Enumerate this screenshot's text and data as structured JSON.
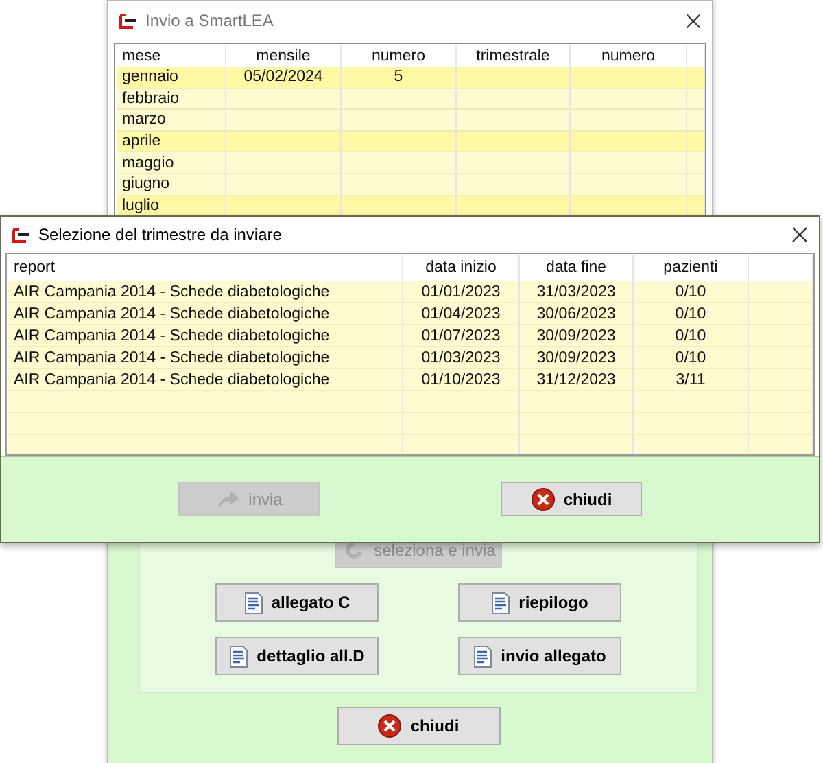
{
  "back_window": {
    "title": "Invio a SmartLEA",
    "table": {
      "columns": [
        "mese",
        "mensile",
        "numero",
        "trimestrale",
        "numero"
      ],
      "rows": [
        {
          "cells": [
            "gennaio",
            "05/02/2024",
            "5"
          ],
          "highlighted": true
        },
        {
          "cells": [
            "febbraio"
          ],
          "highlighted": false
        },
        {
          "cells": [
            "marzo"
          ],
          "highlighted": false
        },
        {
          "cells": [
            "aprile"
          ],
          "highlighted": true
        },
        {
          "cells": [
            "maggio"
          ],
          "highlighted": false
        },
        {
          "cells": [
            "giugno"
          ],
          "highlighted": false
        },
        {
          "cells": [
            "luglio"
          ],
          "highlighted": true
        }
      ]
    },
    "buttons": [
      {
        "label": "seleziona e invia",
        "kind": "swirl",
        "disabled": true
      },
      {
        "label": "allegato C",
        "kind": "document",
        "disabled": false
      },
      {
        "label": "riepilogo",
        "kind": "document",
        "disabled": false
      },
      {
        "label": "dettaglio all.D",
        "kind": "document",
        "disabled": false
      },
      {
        "label": "invio allegato",
        "kind": "document",
        "disabled": false
      }
    ],
    "close_button": {
      "label": "chiudi",
      "kind": "close",
      "disabled": false
    }
  },
  "dialog": {
    "title": "Selezione del trimestre da inviare",
    "table": {
      "columns": [
        "report",
        "data inizio",
        "data fine",
        "pazienti"
      ],
      "rows": [
        {
          "cells": [
            "AIR Campania 2014 - Schede diabetologiche",
            "01/01/2023",
            "31/03/2023",
            "0/10"
          ]
        },
        {
          "cells": [
            "AIR Campania 2014 - Schede diabetologiche",
            "01/04/2023",
            "30/06/2023",
            "0/10"
          ]
        },
        {
          "cells": [
            "AIR Campania 2014 - Schede diabetologiche",
            "01/07/2023",
            "30/09/2023",
            "0/10"
          ]
        },
        {
          "cells": [
            "AIR Campania 2014 - Schede diabetologiche",
            "01/03/2023",
            "30/09/2023",
            "0/10"
          ]
        },
        {
          "cells": [
            "AIR Campania 2014 - Schede diabetologiche",
            "01/10/2023",
            "31/12/2023",
            "3/11"
          ]
        }
      ]
    },
    "buttons": [
      {
        "label": "invia",
        "kind": "upload",
        "disabled": true
      },
      {
        "label": "chiudi",
        "kind": "close",
        "disabled": false
      }
    ]
  }
}
